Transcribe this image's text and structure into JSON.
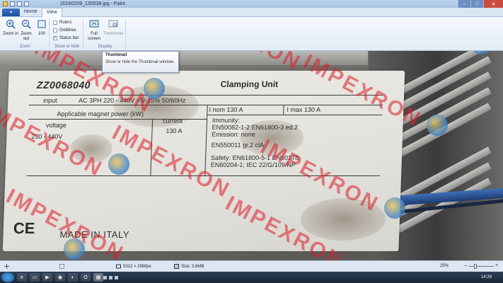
{
  "window": {
    "title": "20160209_135539.jpg - Paint",
    "minimize": "–",
    "maximize": "□",
    "close": "✕"
  },
  "ribbon": {
    "file_menu": "▾",
    "tabs": [
      {
        "label": "Home"
      },
      {
        "label": "View"
      }
    ],
    "zoom_group": {
      "label": "Zoom",
      "zoom_in": "Zoom in",
      "zoom_out": "Zoom out",
      "hundred": "100"
    },
    "show_hide_group": {
      "label": "Show or hide",
      "rulers": "Rulers",
      "gridlines": "Gridlines",
      "status_bar": "Status bar",
      "status_bar_checked": true
    },
    "display_group": {
      "label": "Display",
      "full_screen": "Full screen",
      "thumbnail": "Thumbnail"
    }
  },
  "tooltip": {
    "title": "Thumbnail",
    "body": "Show or hide the Thumbnail window."
  },
  "photo": {
    "part_code": "ZZ0068040",
    "unit_name": "Clamping Unit",
    "input_label": "input",
    "input_value": "AC 3PH 220 - 440V +5/-15%  50/60Hz",
    "inom": "I nom   130   A",
    "imax": "I max   130   A",
    "magnet_power": "Applicable magnet power (kW)",
    "voltage_label": "voltage",
    "current_label": "current",
    "voltage_value": "230 - 440V",
    "current_value": "130 A",
    "immunity_1": "Immunity:",
    "immunity_2": "EN50082-1-2 EN61800-3 ed.2",
    "emission": "Emission: none",
    "en550011": "EN550011 gr.2 clA",
    "safety_1": "Safety: EN61800-5-1  EN50178;",
    "safety_2": "EN60204-1; IEC 22/G/109/NP",
    "ce_mark": "CE",
    "made_in": "MADE IN ITALY"
  },
  "watermark": {
    "text": "IMPEXRON"
  },
  "statusbar": {
    "dimensions": "5312 × 2988px",
    "size": "Size: 3,6MB",
    "zoom": "25%",
    "zoom_fraction": 0.25
  },
  "taskbar": {
    "clock": "14:29"
  }
}
